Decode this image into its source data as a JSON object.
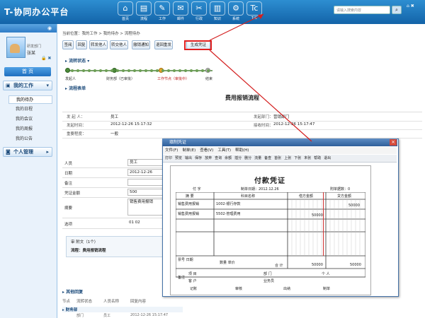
{
  "app": {
    "title": "T-协同办公平台"
  },
  "top_nav": [
    {
      "label": "首页",
      "icon": "home-icon",
      "glyph": "⌂"
    },
    {
      "label": "流程",
      "icon": "flow-icon",
      "glyph": "▤"
    },
    {
      "label": "工作",
      "icon": "work-icon",
      "glyph": "✎"
    },
    {
      "label": "邮件",
      "icon": "mail-icon",
      "glyph": "✉"
    },
    {
      "label": "行政",
      "icon": "admin-icon",
      "glyph": "✂"
    },
    {
      "label": "知识",
      "icon": "knowledge-icon",
      "glyph": "▥"
    },
    {
      "label": "系统",
      "icon": "system-icon",
      "glyph": "⚙"
    },
    {
      "label": "T/C",
      "icon": "tc-icon",
      "glyph": "Tc"
    }
  ],
  "search": {
    "placeholder": "请输入搜索内容"
  },
  "user": {
    "dept": "研发部门",
    "name": "张某"
  },
  "sidebar": {
    "home": "首 页",
    "my_work": "我的工作",
    "items": [
      "我的待办",
      "我的日程",
      "我的会议",
      "我的周报",
      "我的公告"
    ],
    "personal": "个人管理"
  },
  "breadcrumb": "当前位置：我的工作 > 我的待办 > 流程待办",
  "toolbar": [
    "签阅",
    "回复",
    "转发他人",
    "转交他人",
    "撤销通知",
    "退回重发",
    "生成凭证"
  ],
  "status_section": "流转状态",
  "flow_nodes": [
    {
      "label": "发起人",
      "state": "done"
    },
    {
      "label": "财务部（已审批）",
      "state": "done"
    },
    {
      "label": "工作节点（审批中）",
      "state": "current"
    },
    {
      "label": "结束",
      "state": "pending"
    }
  ],
  "form_section": "流程表单",
  "form": {
    "title": "费用报销流程",
    "fields": [
      {
        "label": "发 起 人：",
        "value": "员工",
        "label2": "发起部门：",
        "value2": "营销部门"
      },
      {
        "label": "发起时间：",
        "value": "2012-12-26 15:17:32",
        "label2": "接收时间：",
        "value2": "2012-12-26 15:17:47"
      },
      {
        "label": "重要程度：",
        "value": "一般",
        "label2": "",
        "value2": ""
      }
    ]
  },
  "detail": [
    {
      "label": "人员",
      "value": "员工"
    },
    {
      "label": "日期",
      "value": "2012-12-26"
    },
    {
      "label": "备注",
      "value": ""
    },
    {
      "label": "凭证金额",
      "value": "500"
    },
    {
      "label": "摘要",
      "value": "销售费用报销"
    },
    {
      "label": "选项",
      "value": "01  02"
    }
  ],
  "note": {
    "text1": "审 附文（1个）",
    "text2": "流程：费用报销流程"
  },
  "lower": {
    "title": "其他回复",
    "headers": [
      "节点",
      "流转状态",
      "人员名称",
      "回复内容"
    ],
    "dept": "财务部",
    "row": [
      "部门",
      "员工",
      "2012-12-26 15:17:47"
    ]
  },
  "popup": {
    "title": "填制凭证",
    "menu": [
      "文件(F)",
      "制单(E)",
      "查看(V)",
      "工具(T)",
      "帮助(H)"
    ],
    "toolbar": [
      "打印",
      "预览",
      "输出",
      "保存",
      "放弃",
      "查询",
      "余额",
      "插分",
      "删分",
      "流量",
      "备查",
      "首张",
      "上张",
      "下张",
      "末张",
      "帮助",
      "退出"
    ],
    "voucher": {
      "title": "付款凭证",
      "type": "付 字",
      "date": "制单日期：2012.12.26",
      "attachments": "附单据数：0",
      "col_summary": "摘 要",
      "col_account": "科目名称",
      "col_debit": "借方金额",
      "col_credit": "贷方金额",
      "rows": [
        {
          "summary": "销售费用报销",
          "account": "1002-银行存款",
          "debit": "",
          "credit": "50000"
        },
        {
          "summary": "销售费用报销",
          "account": "5502-管理费用",
          "debit": "50000",
          "credit": ""
        }
      ],
      "notes_label": "票号\n日期",
      "qty_label": "数量\n单价",
      "total_label": "合 计",
      "total_debit": "50000",
      "total_credit": "50000",
      "remark": "备注",
      "project": "项 目",
      "dept_label": "部 门",
      "person_label": "个 人",
      "client": "客 户",
      "salesman": "业务员",
      "bookkeeper": "记账",
      "reviewer": "审核",
      "cashier": "出纳",
      "maker": "制单"
    }
  }
}
